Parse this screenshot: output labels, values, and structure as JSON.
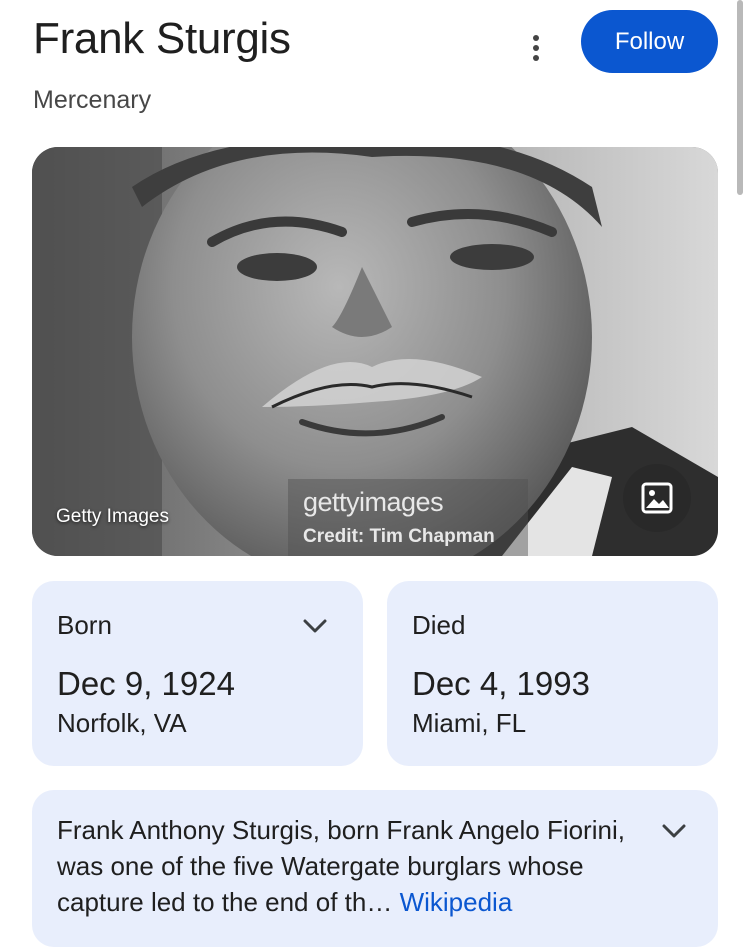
{
  "header": {
    "title": "Frank Sturgis",
    "subtitle": "Mercenary",
    "follow_label": "Follow",
    "more_icon": "more-vert-icon"
  },
  "photo": {
    "source_label": "Getty Images",
    "watermark_logo": "gettyimages",
    "watermark_credit": "Credit: Tim Chapman",
    "gallery_icon": "image-gallery-icon"
  },
  "facts": [
    {
      "label": "Born",
      "date": "Dec 9, 1924",
      "place": "Norfolk, VA"
    },
    {
      "label": "Died",
      "date": "Dec 4, 1993",
      "place": "Miami, FL"
    }
  ],
  "description": {
    "text": "Frank Anthony Sturgis, born Frank Angelo Fiorini, was one of the five Watergate burglars whose capture led to the end of th…",
    "source": "Wikipedia"
  },
  "colors": {
    "accent": "#0b57d0",
    "card_bg": "#e8eefc"
  }
}
